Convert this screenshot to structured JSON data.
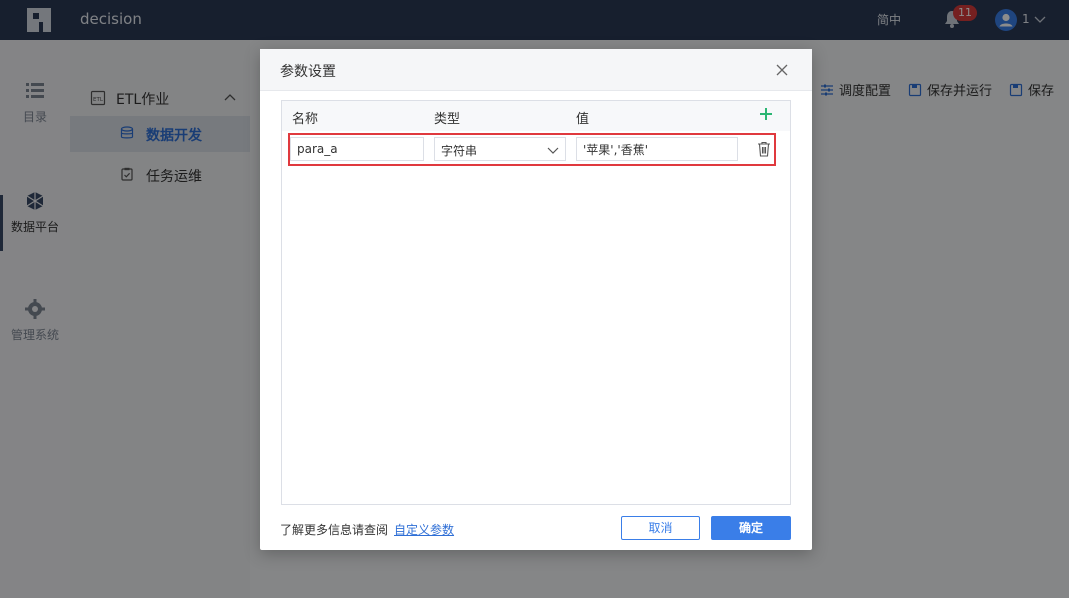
{
  "app": {
    "title": "decision"
  },
  "header": {
    "language_label": "简中",
    "notification_count": "11",
    "user_label": "1"
  },
  "rail": {
    "items": [
      {
        "label": "目录",
        "icon": "list-icon"
      },
      {
        "label": "数据平台",
        "icon": "cubes-icon",
        "active": true
      },
      {
        "label": "管理系统",
        "icon": "gear-icon"
      }
    ]
  },
  "subnav": {
    "group_label": "ETL作业",
    "items": [
      {
        "label": "数据开发",
        "active": true
      },
      {
        "label": "任务运维"
      }
    ]
  },
  "toolbar": {
    "schedule_label": "调度配置",
    "save_run_label": "保存并运行",
    "save_label": "保存"
  },
  "dialog": {
    "title": "参数设置",
    "columns": [
      "名称",
      "类型",
      "值"
    ],
    "rows": [
      {
        "name": "para_a",
        "type": "字符串",
        "value": "'苹果','香蕉'"
      }
    ],
    "footer_text": "了解更多信息请查阅",
    "footer_link": "自定义参数",
    "cancel_label": "取消",
    "ok_label": "确定"
  },
  "colors": {
    "topbar": "#2b3a55",
    "accent": "#3a7ee8",
    "highlight_outline": "#e0393e",
    "add_icon": "#2bb673"
  }
}
